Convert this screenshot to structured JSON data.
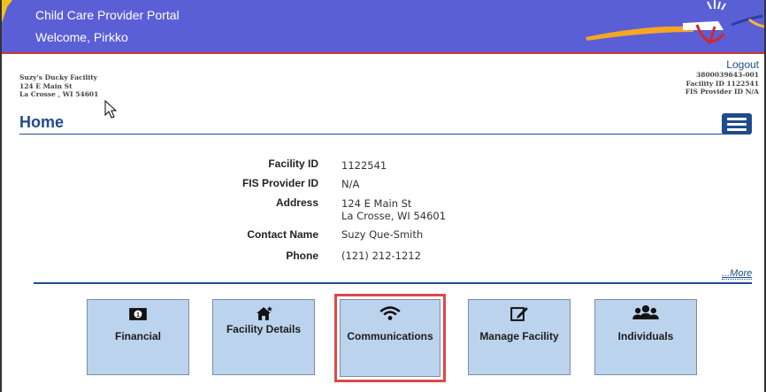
{
  "header": {
    "title": "Child Care Provider Portal",
    "welcome": "Welcome, Pirkko",
    "banner_color": "#5b5fd6"
  },
  "facility_left": {
    "name": "Suzy's Ducky Facility",
    "street": "124 E Main St",
    "city": "La Crosse , WI 54601"
  },
  "facility_right": {
    "logout": "Logout",
    "account": "3800039643-001",
    "facility_id": "Facility ID 1122541",
    "fis_provider": "FIS Provider ID N/A"
  },
  "page": {
    "title": "Home",
    "menu_icon": "hamburger-menu-icon"
  },
  "details": {
    "facility_id_label": "Facility ID",
    "facility_id_value": "1122541",
    "fis_label": "FIS Provider ID",
    "fis_value": "N/A",
    "address_label": "Address",
    "address_line1": "124 E Main St",
    "address_line2": "La Crosse, WI 54601",
    "contact_label": "Contact Name",
    "contact_value": "Suzy Que-Smith",
    "phone_label": "Phone",
    "phone_value": "(121) 212-1212"
  },
  "more_link": "...More",
  "tiles": [
    {
      "label": "Financial",
      "icon": "money-icon"
    },
    {
      "label": "Facility Details",
      "icon": "house-icon"
    },
    {
      "label": "Communications",
      "icon": "wifi-icon"
    },
    {
      "label": "Manage Facility",
      "icon": "edit-icon"
    },
    {
      "label": "Individuals",
      "icon": "users-icon"
    }
  ],
  "colors": {
    "accent": "#1f4b8c",
    "tile_bg": "#bcd3ee",
    "highlight": "#e0474a"
  }
}
